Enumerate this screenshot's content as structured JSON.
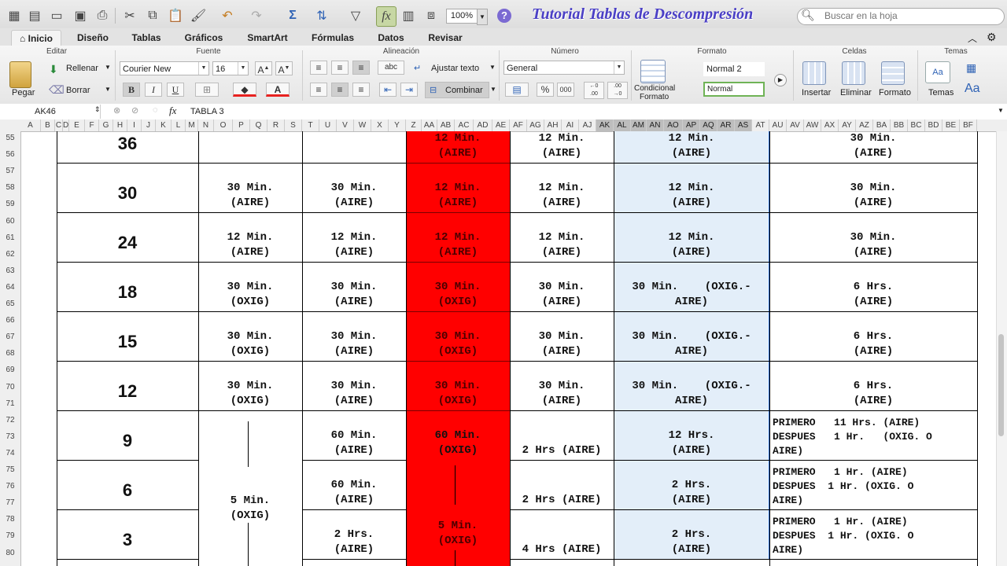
{
  "toolbar": {
    "zoom": "100%",
    "title": "Tutorial Tablas de Descompresión",
    "search_placeholder": "Buscar en la hoja"
  },
  "tabs": [
    "Inicio",
    "Diseño",
    "Tablas",
    "Gráficos",
    "SmartArt",
    "Fórmulas",
    "Datos",
    "Revisar"
  ],
  "ribbon": {
    "groups": [
      "Editar",
      "Fuente",
      "Alineación",
      "Número",
      "Formato",
      "Celdas",
      "Temas"
    ],
    "paste": "Pegar",
    "fill": "Rellenar",
    "clear": "Borrar",
    "font_name": "Courier New",
    "font_size": "16",
    "wrap": "Ajustar texto",
    "merge": "Combinar",
    "number_format": "General",
    "cond_format_1": "Condicional",
    "cond_format_2": "Formato",
    "style_1": "Normal 2",
    "style_2": "Normal",
    "insert": "Insertar",
    "delete": "Eliminar",
    "format": "Formato",
    "themes": "Temas"
  },
  "formula_bar": {
    "cell_ref": "AK46",
    "formula": "TABLA 3"
  },
  "columns": [
    "A",
    "B",
    "C",
    "D",
    "E",
    "F",
    "G",
    "H",
    "I",
    "J",
    "K",
    "L",
    "M",
    "N",
    "O",
    "P",
    "Q",
    "R",
    "S",
    "T",
    "U",
    "V",
    "W",
    "X",
    "Y",
    "Z",
    "AA",
    "AB",
    "AC",
    "AD",
    "AE",
    "AF",
    "AG",
    "AH",
    "AI",
    "AJ",
    "AK",
    "AL",
    "AM",
    "AN",
    "AO",
    "AP",
    "AQ",
    "AR",
    "AS",
    "AT",
    "AU",
    "AV",
    "AW",
    "AX",
    "AY",
    "AZ",
    "BA",
    "BB",
    "BC",
    "BD",
    "BE",
    "BF"
  ],
  "rows": [
    "55",
    "56",
    "57",
    "58",
    "59",
    "60",
    "61",
    "62",
    "63",
    "64",
    "65",
    "66",
    "67",
    "68",
    "69",
    "70",
    "71",
    "72",
    "73",
    "74",
    "75",
    "76",
    "77",
    "78",
    "79",
    "80"
  ],
  "table": {
    "depths": [
      "36",
      "30",
      "24",
      "18",
      "15",
      "12",
      "9",
      "6",
      "3"
    ],
    "r0": [
      "",
      "",
      "12 Min.\n(AIRE)",
      "12 Min.\n(AIRE)",
      "12 Min.\n(AIRE)",
      "30 Min.\n(AIRE)"
    ],
    "r1": [
      "30 Min.\n(AIRE)",
      "30 Min.\n(AIRE)",
      "12 Min.\n(AIRE)",
      "12 Min.\n(AIRE)",
      "12 Min.\n(AIRE)",
      "30 Min.\n(AIRE)"
    ],
    "r2": [
      "12 Min.\n(AIRE)",
      "12 Min.\n(AIRE)",
      "12 Min.\n(AIRE)",
      "12 Min.\n(AIRE)",
      "12 Min.\n(AIRE)",
      "30 Min.\n(AIRE)"
    ],
    "r3": [
      "30 Min.\n(OXIG)",
      "30 Min.\n(AIRE)",
      "30 Min.\n(OXIG)",
      "30 Min.\n(AIRE)",
      "30 Min.    (OXIG.-\nAIRE)",
      "6 Hrs.\n(AIRE)"
    ],
    "r4": [
      "30 Min.\n(OXIG)",
      "30 Min.\n(AIRE)",
      "30 Min.\n(OXIG)",
      "30 Min.\n(AIRE)",
      "30 Min.    (OXIG.-\nAIRE)",
      "6 Hrs.\n(AIRE)"
    ],
    "r5": [
      "30 Min.\n(OXIG)",
      "30 Min.\n(AIRE)",
      "30 Min.\n(OXIG)",
      "30 Min.\n(AIRE)",
      "30 Min.    (OXIG.-\nAIRE)",
      "6 Hrs.\n(AIRE)"
    ],
    "r6": [
      "",
      "60 Min.\n(AIRE)",
      "60 Min.\n(OXIG)",
      "2 Hrs (AIRE)",
      "12 Hrs.\n(AIRE)",
      "PRIMERO   11 Hrs. (AIRE)\nDESPUES   1 Hr.   (OXIG. O\nAIRE)"
    ],
    "r7": [
      "",
      "60 Min.\n(AIRE)",
      "",
      "2 Hrs (AIRE)",
      "2 Hrs.\n(AIRE)",
      "PRIMERO   1 Hr. (AIRE)\nDESPUES  1 Hr. (OXIG. O\nAIRE)"
    ],
    "r8": [
      "",
      "2 Hrs.\n(AIRE)",
      "",
      "4 Hrs (AIRE)",
      "2 Hrs.\n(AIRE)",
      "PRIMERO   1 Hr. (AIRE)\nDESPUES  1 Hr. (OXIG. O\nAIRE)"
    ],
    "merged_c1": "5 Min.\n(OXIG)",
    "merged_c3": "5 Min.\n(OXIG)"
  },
  "colors": {
    "red_column": "#ff0000",
    "selection": "#e3eef9",
    "selection_border": "#2a6bd1",
    "title": "#4a3fc6"
  }
}
